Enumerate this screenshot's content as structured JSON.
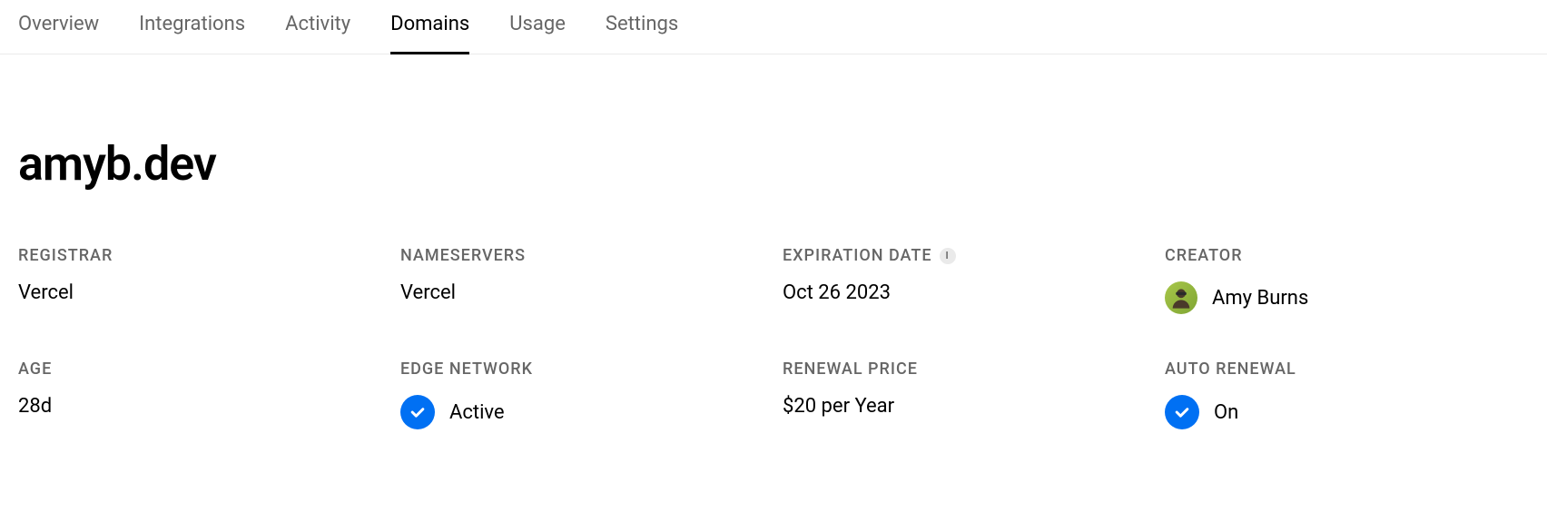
{
  "tabs": {
    "items": [
      {
        "label": "Overview",
        "active": false
      },
      {
        "label": "Integrations",
        "active": false
      },
      {
        "label": "Activity",
        "active": false
      },
      {
        "label": "Domains",
        "active": true
      },
      {
        "label": "Usage",
        "active": false
      },
      {
        "label": "Settings",
        "active": false
      }
    ]
  },
  "domain": {
    "name": "amyb.dev",
    "fields": {
      "registrar": {
        "label": "REGISTRAR",
        "value": "Vercel"
      },
      "nameservers": {
        "label": "NAMESERVERS",
        "value": "Vercel"
      },
      "expiration": {
        "label": "EXPIRATION DATE",
        "value": "Oct 26 2023"
      },
      "creator": {
        "label": "CREATOR",
        "value": "Amy Burns"
      },
      "age": {
        "label": "AGE",
        "value": "28d"
      },
      "edge_network": {
        "label": "EDGE NETWORK",
        "value": "Active"
      },
      "renewal_price": {
        "label": "RENEWAL PRICE",
        "value": "$20 per Year"
      },
      "auto_renewal": {
        "label": "AUTO RENEWAL",
        "value": "On"
      }
    }
  }
}
